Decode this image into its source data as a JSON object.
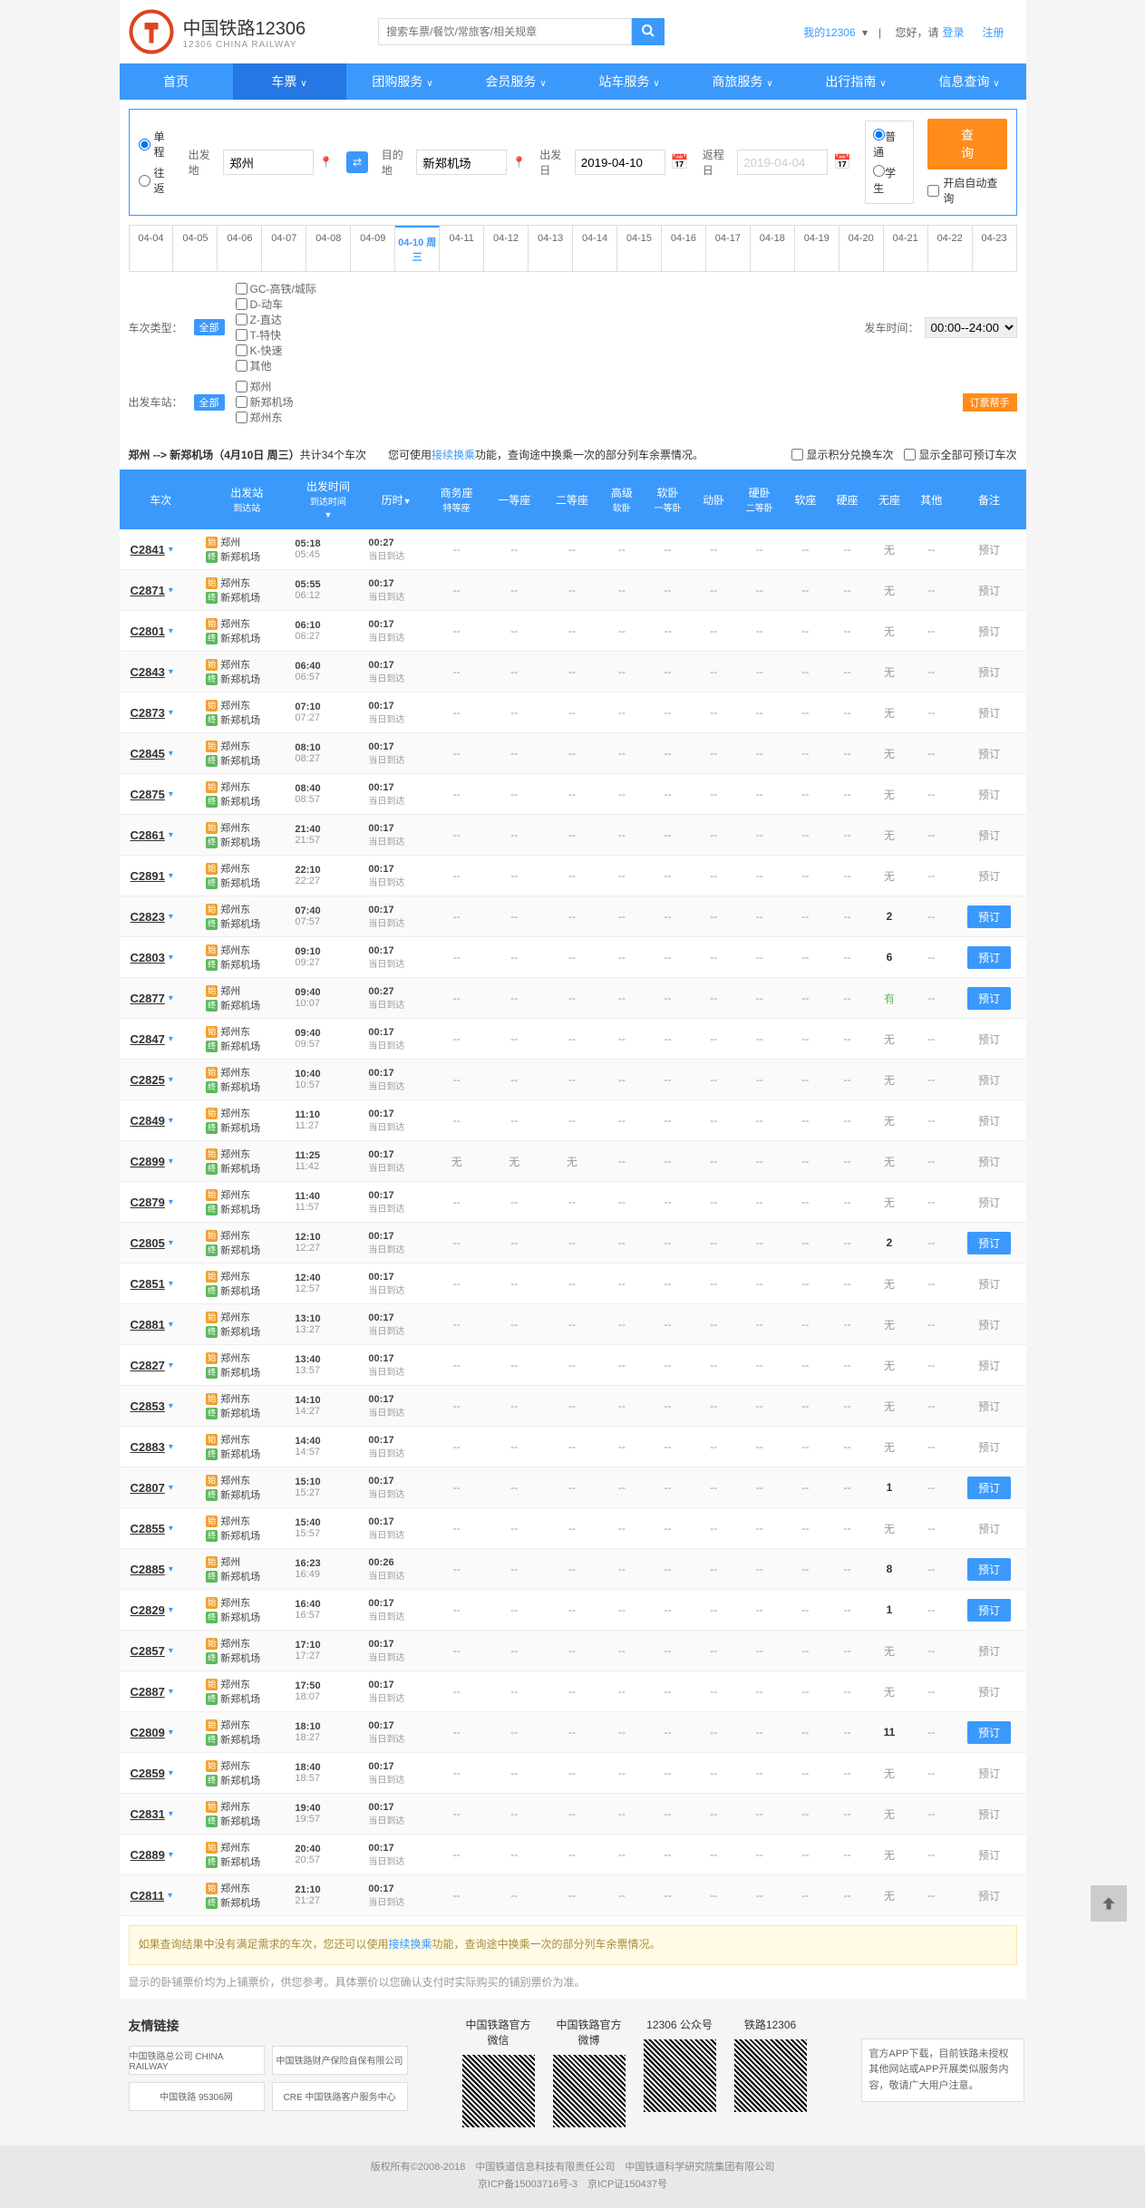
{
  "brand": {
    "title": "中国铁路12306",
    "sub": "12306 CHINA RAILWAY"
  },
  "search": {
    "placeholder": "搜索车票/餐饮/常旅客/相关规章"
  },
  "user": {
    "my": "我的12306",
    "greet": "您好，请",
    "login": "登录",
    "reg": "注册"
  },
  "nav": [
    "首页",
    "车票",
    "团购服务",
    "会员服务",
    "站车服务",
    "商旅服务",
    "出行指南",
    "信息查询"
  ],
  "trip": {
    "single": "单程",
    "round": "往返"
  },
  "fields": {
    "from_label": "出发地",
    "from": "郑州",
    "to_label": "目的地",
    "to": "新郑机场",
    "date_label": "出发日",
    "date": "2019-04-10",
    "ret_label": "返程日",
    "ret": "2019-04-04"
  },
  "pass": {
    "normal": "普通",
    "student": "学生"
  },
  "query_btn": "查询",
  "auto": "开启自动查询",
  "dates": [
    "04-04",
    "04-05",
    "04-06",
    "04-07",
    "04-08",
    "04-09",
    "04-10 周三",
    "04-11",
    "04-12",
    "04-13",
    "04-14",
    "04-15",
    "04-16",
    "04-17",
    "04-18",
    "04-19",
    "04-20",
    "04-21",
    "04-22",
    "04-23"
  ],
  "filter": {
    "type_label": "车次类型：",
    "all": "全部",
    "types": [
      "GC-高铁/城际",
      "D-动车",
      "Z-直达",
      "T-特快",
      "K-快速",
      "其他"
    ],
    "from_label": "出发车站：",
    "stations": [
      "郑州",
      "新郑机场",
      "郑州东"
    ],
    "time_label": "发车时间：",
    "time_val": "00:00--24:00",
    "helper": "订票帮手"
  },
  "route": {
    "from": "郑州",
    "to": "新郑机场",
    "date": "4月10日  周三",
    "count": "34",
    "count_suffix": "个车次",
    "hint1": "您可使用",
    "link": "接续换乘",
    "hint2": "功能，查询途中换乘一次的部分列车余票情况。",
    "opt1": "显示积分兑换车次",
    "opt2": "显示全部可预订车次"
  },
  "cols": [
    "车次",
    "出发站\n到达站",
    "出发时间\n到达时间",
    "历时",
    "商务座\n特等座",
    "一等座",
    "二等座",
    "高级\n软卧",
    "软卧\n一等卧",
    "动卧",
    "硬卧\n二等卧",
    "软座",
    "硬座",
    "无座",
    "其他",
    "备注"
  ],
  "trains": [
    {
      "no": "C2841",
      "f": "郑州",
      "t": "新郑机场",
      "d": "05:18",
      "a": "05:45",
      "dur": "00:27",
      "wz": "无",
      "book": false
    },
    {
      "no": "C2871",
      "f": "郑州东",
      "t": "新郑机场",
      "d": "05:55",
      "a": "06:12",
      "dur": "00:17",
      "wz": "无",
      "book": false
    },
    {
      "no": "C2801",
      "f": "郑州东",
      "t": "新郑机场",
      "d": "06:10",
      "a": "06:27",
      "dur": "00:17",
      "wz": "无",
      "book": false
    },
    {
      "no": "C2843",
      "f": "郑州东",
      "t": "新郑机场",
      "d": "06:40",
      "a": "06:57",
      "dur": "00:17",
      "wz": "无",
      "book": false
    },
    {
      "no": "C2873",
      "f": "郑州东",
      "t": "新郑机场",
      "d": "07:10",
      "a": "07:27",
      "dur": "00:17",
      "wz": "无",
      "book": false
    },
    {
      "no": "C2845",
      "f": "郑州东",
      "t": "新郑机场",
      "d": "08:10",
      "a": "08:27",
      "dur": "00:17",
      "wz": "无",
      "book": false
    },
    {
      "no": "C2875",
      "f": "郑州东",
      "t": "新郑机场",
      "d": "08:40",
      "a": "08:57",
      "dur": "00:17",
      "wz": "无",
      "book": false
    },
    {
      "no": "C2861",
      "f": "郑州东",
      "t": "新郑机场",
      "d": "21:40",
      "a": "21:57",
      "dur": "00:17",
      "wz": "无",
      "book": false
    },
    {
      "no": "C2891",
      "f": "郑州东",
      "t": "新郑机场",
      "d": "22:10",
      "a": "22:27",
      "dur": "00:17",
      "wz": "无",
      "book": false
    },
    {
      "no": "C2823",
      "f": "郑州东",
      "t": "新郑机场",
      "d": "07:40",
      "a": "07:57",
      "dur": "00:17",
      "wz": "2",
      "book": true
    },
    {
      "no": "C2803",
      "f": "郑州东",
      "t": "新郑机场",
      "d": "09:10",
      "a": "09:27",
      "dur": "00:17",
      "wz": "6",
      "book": true
    },
    {
      "no": "C2877",
      "f": "郑州",
      "t": "新郑机场",
      "d": "09:40",
      "a": "10:07",
      "dur": "00:27",
      "wz": "有",
      "wzc": "green",
      "book": true
    },
    {
      "no": "C2847",
      "f": "郑州东",
      "t": "新郑机场",
      "d": "09:40",
      "a": "09:57",
      "dur": "00:17",
      "wz": "无",
      "book": false
    },
    {
      "no": "C2825",
      "f": "郑州东",
      "t": "新郑机场",
      "d": "10:40",
      "a": "10:57",
      "dur": "00:17",
      "wz": "无",
      "book": false
    },
    {
      "no": "C2849",
      "f": "郑州东",
      "t": "新郑机场",
      "d": "11:10",
      "a": "11:27",
      "dur": "00:17",
      "wz": "无",
      "book": false
    },
    {
      "no": "C2899",
      "f": "郑州东",
      "t": "新郑机场",
      "d": "11:25",
      "a": "11:42",
      "dur": "00:17",
      "s1": "无",
      "s2": "无",
      "s3": "无",
      "wz": "无",
      "book": false
    },
    {
      "no": "C2879",
      "f": "郑州东",
      "t": "新郑机场",
      "d": "11:40",
      "a": "11:57",
      "dur": "00:17",
      "wz": "无",
      "book": false
    },
    {
      "no": "C2805",
      "f": "郑州东",
      "t": "新郑机场",
      "d": "12:10",
      "a": "12:27",
      "dur": "00:17",
      "wz": "2",
      "book": true
    },
    {
      "no": "C2851",
      "f": "郑州东",
      "t": "新郑机场",
      "d": "12:40",
      "a": "12:57",
      "dur": "00:17",
      "wz": "无",
      "book": false
    },
    {
      "no": "C2881",
      "f": "郑州东",
      "t": "新郑机场",
      "d": "13:10",
      "a": "13:27",
      "dur": "00:17",
      "wz": "无",
      "book": false
    },
    {
      "no": "C2827",
      "f": "郑州东",
      "t": "新郑机场",
      "d": "13:40",
      "a": "13:57",
      "dur": "00:17",
      "wz": "无",
      "book": false
    },
    {
      "no": "C2853",
      "f": "郑州东",
      "t": "新郑机场",
      "d": "14:10",
      "a": "14:27",
      "dur": "00:17",
      "wz": "无",
      "book": false
    },
    {
      "no": "C2883",
      "f": "郑州东",
      "t": "新郑机场",
      "d": "14:40",
      "a": "14:57",
      "dur": "00:17",
      "wz": "无",
      "book": false
    },
    {
      "no": "C2807",
      "f": "郑州东",
      "t": "新郑机场",
      "d": "15:10",
      "a": "15:27",
      "dur": "00:17",
      "wz": "1",
      "book": true
    },
    {
      "no": "C2855",
      "f": "郑州东",
      "t": "新郑机场",
      "d": "15:40",
      "a": "15:57",
      "dur": "00:17",
      "wz": "无",
      "book": false
    },
    {
      "no": "C2885",
      "f": "郑州",
      "t": "新郑机场",
      "d": "16:23",
      "a": "16:49",
      "dur": "00:26",
      "wz": "8",
      "book": true
    },
    {
      "no": "C2829",
      "f": "郑州东",
      "t": "新郑机场",
      "d": "16:40",
      "a": "16:57",
      "dur": "00:17",
      "wz": "1",
      "book": true
    },
    {
      "no": "C2857",
      "f": "郑州东",
      "t": "新郑机场",
      "d": "17:10",
      "a": "17:27",
      "dur": "00:17",
      "wz": "无",
      "book": false
    },
    {
      "no": "C2887",
      "f": "郑州东",
      "t": "新郑机场",
      "d": "17:50",
      "a": "18:07",
      "dur": "00:17",
      "wz": "无",
      "book": false
    },
    {
      "no": "C2809",
      "f": "郑州东",
      "t": "新郑机场",
      "d": "18:10",
      "a": "18:27",
      "dur": "00:17",
      "wz": "11",
      "book": true
    },
    {
      "no": "C2859",
      "f": "郑州东",
      "t": "新郑机场",
      "d": "18:40",
      "a": "18:57",
      "dur": "00:17",
      "wz": "无",
      "book": false
    },
    {
      "no": "C2831",
      "f": "郑州东",
      "t": "新郑机场",
      "d": "19:40",
      "a": "19:57",
      "dur": "00:17",
      "wz": "无",
      "book": false
    },
    {
      "no": "C2889",
      "f": "郑州东",
      "t": "新郑机场",
      "d": "20:40",
      "a": "20:57",
      "dur": "00:17",
      "wz": "无",
      "book": false
    },
    {
      "no": "C2811",
      "f": "郑州东",
      "t": "新郑机场",
      "d": "21:10",
      "a": "21:27",
      "dur": "00:17",
      "wz": "无",
      "book": false
    }
  ],
  "arrive_same": "当日到达",
  "book_label": "预订",
  "tip": {
    "t1": "如果查询结果中没有满足需求的车次，您还可以使用",
    "link": "接续换乘",
    "t2": "功能，查询途中换乘一次的部分列车余票情况。"
  },
  "price_note": "显示的卧铺票价均为上铺票价，供您参考。具体票价以您确认支付时实际购买的铺别票价为准。",
  "footer": {
    "links_title": "友情链接",
    "logos": [
      "中国铁路总公司 CHINA RAILWAY",
      "中国铁路财产保险自保有限公司",
      "中国铁路 95306网",
      "CRE 中国铁路客户服务中心"
    ],
    "qr": [
      "中国铁路官方微信",
      "中国铁路官方微博",
      "12306 公众号",
      "铁路12306"
    ],
    "app": "官方APP下载，目前铁路未授权其他网站或APP开展类似服务内容，敬请广大用户注意。"
  },
  "copyright": {
    "l1": "版权所有©2008-2018　中国铁道信息科技有限责任公司　中国铁道科学研究院集团有限公司",
    "l2": "京ICP备15003716号-3　京ICP证150437号"
  }
}
